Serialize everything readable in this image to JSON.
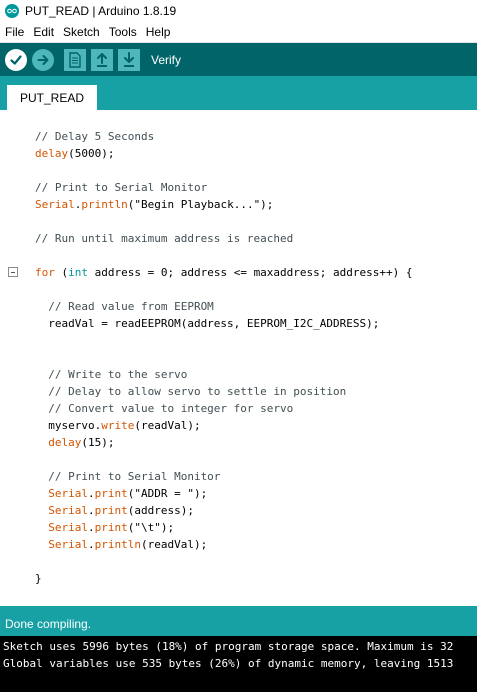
{
  "window": {
    "title": "PUT_READ | Arduino 1.8.19",
    "logo_icon": "arduino-logo-icon"
  },
  "menu": [
    "File",
    "Edit",
    "Sketch",
    "Tools",
    "Help"
  ],
  "toolbar": {
    "hover_label": "Verify",
    "buttons": [
      "verify-icon",
      "upload-icon",
      "new-icon",
      "open-icon",
      "save-icon"
    ]
  },
  "tabs": [
    {
      "label": "PUT_READ",
      "active": true
    }
  ],
  "code_lines": [
    [
      {
        "t": "// Delay 5 Seconds",
        "k": "comment"
      }
    ],
    [
      {
        "t": "delay",
        "k": "keyword"
      },
      {
        "t": "(5000);",
        "k": "plain"
      }
    ],
    [],
    [
      {
        "t": "// Print to Serial Monitor",
        "k": "comment"
      }
    ],
    [
      {
        "t": "Serial",
        "k": "keyword"
      },
      {
        "t": ".",
        "k": "plain"
      },
      {
        "t": "println",
        "k": "keyword"
      },
      {
        "t": "(\"Begin Playback...\");",
        "k": "plain"
      }
    ],
    [],
    [
      {
        "t": "// Run until maximum address is reached",
        "k": "comment"
      }
    ],
    [],
    [
      {
        "t": "for",
        "k": "keyword"
      },
      {
        "t": " (",
        "k": "plain"
      },
      {
        "t": "int",
        "k": "type"
      },
      {
        "t": " address = 0; address <= maxaddress; address++) {",
        "k": "plain"
      }
    ],
    [],
    [
      {
        "t": "  // Read value from EEPROM",
        "k": "comment"
      }
    ],
    [
      {
        "t": "  readVal = readEEPROM(address, EEPROM_I2C_ADDRESS);",
        "k": "plain"
      }
    ],
    [],
    [],
    [
      {
        "t": "  // Write to the servo",
        "k": "comment"
      }
    ],
    [
      {
        "t": "  // Delay to allow servo to settle in position",
        "k": "comment"
      }
    ],
    [
      {
        "t": "  // Convert value to integer for servo",
        "k": "comment"
      }
    ],
    [
      {
        "t": "  myservo.",
        "k": "plain"
      },
      {
        "t": "write",
        "k": "keyword"
      },
      {
        "t": "(readVal);",
        "k": "plain"
      }
    ],
    [
      {
        "t": "  ",
        "k": "plain"
      },
      {
        "t": "delay",
        "k": "keyword"
      },
      {
        "t": "(15);",
        "k": "plain"
      }
    ],
    [],
    [
      {
        "t": "  // Print to Serial Monitor",
        "k": "comment"
      }
    ],
    [
      {
        "t": "  ",
        "k": "plain"
      },
      {
        "t": "Serial",
        "k": "keyword"
      },
      {
        "t": ".",
        "k": "plain"
      },
      {
        "t": "print",
        "k": "keyword"
      },
      {
        "t": "(\"ADDR = \");",
        "k": "plain"
      }
    ],
    [
      {
        "t": "  ",
        "k": "plain"
      },
      {
        "t": "Serial",
        "k": "keyword"
      },
      {
        "t": ".",
        "k": "plain"
      },
      {
        "t": "print",
        "k": "keyword"
      },
      {
        "t": "(address);",
        "k": "plain"
      }
    ],
    [
      {
        "t": "  ",
        "k": "plain"
      },
      {
        "t": "Serial",
        "k": "keyword"
      },
      {
        "t": ".",
        "k": "plain"
      },
      {
        "t": "print",
        "k": "keyword"
      },
      {
        "t": "(\"\\t\");",
        "k": "plain"
      }
    ],
    [
      {
        "t": "  ",
        "k": "plain"
      },
      {
        "t": "Serial",
        "k": "keyword"
      },
      {
        "t": ".",
        "k": "plain"
      },
      {
        "t": "println",
        "k": "keyword"
      },
      {
        "t": "(readVal);",
        "k": "plain"
      }
    ],
    [],
    [
      {
        "t": "}",
        "k": "plain"
      }
    ]
  ],
  "fold_marker_line": 9,
  "status": {
    "text": "Done compiling."
  },
  "console": [
    "Sketch uses 5996 bytes (18%) of program storage space. Maximum is 32",
    "Global variables use 535 bytes (26%) of dynamic memory, leaving 1513"
  ],
  "colors": {
    "toolbar": "#006468",
    "tabbar": "#17a1a5",
    "keyword": "#d35400",
    "type": "#00979c",
    "comment": "#434f54"
  }
}
